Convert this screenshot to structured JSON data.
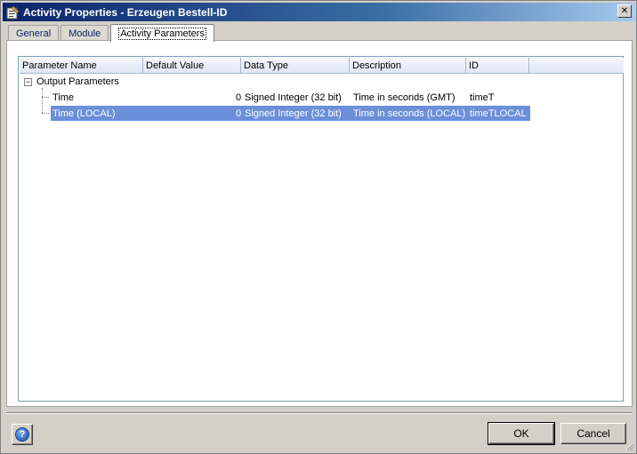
{
  "window": {
    "title": "Activity Properties - Erzeugen Bestell-ID",
    "close_glyph": "✕"
  },
  "tabs": [
    {
      "label": "General",
      "active": false
    },
    {
      "label": "Module",
      "active": false
    },
    {
      "label": "Activity Parameters",
      "active": true
    }
  ],
  "table": {
    "columns": [
      "Parameter Name",
      "Default Value",
      "Data Type",
      "Description",
      "ID"
    ],
    "group": {
      "label": "Output Parameters",
      "expander": "−"
    },
    "rows": [
      {
        "name": "Time",
        "default": "0",
        "type": "Signed Integer (32 bit)",
        "description": "Time in seconds (GMT)",
        "id": "timeT",
        "selected": false
      },
      {
        "name": "Time (LOCAL)",
        "default": "0",
        "type": "Signed Integer (32 bit)",
        "description": "Time in seconds (LOCAL)",
        "id": "timeTLOCAL",
        "selected": true
      }
    ]
  },
  "buttons": {
    "help_glyph": "?",
    "ok_label": "OK",
    "cancel_label": "Cancel"
  },
  "colors": {
    "selection": "#6b8fd9",
    "titlebar": "#0a246a"
  }
}
